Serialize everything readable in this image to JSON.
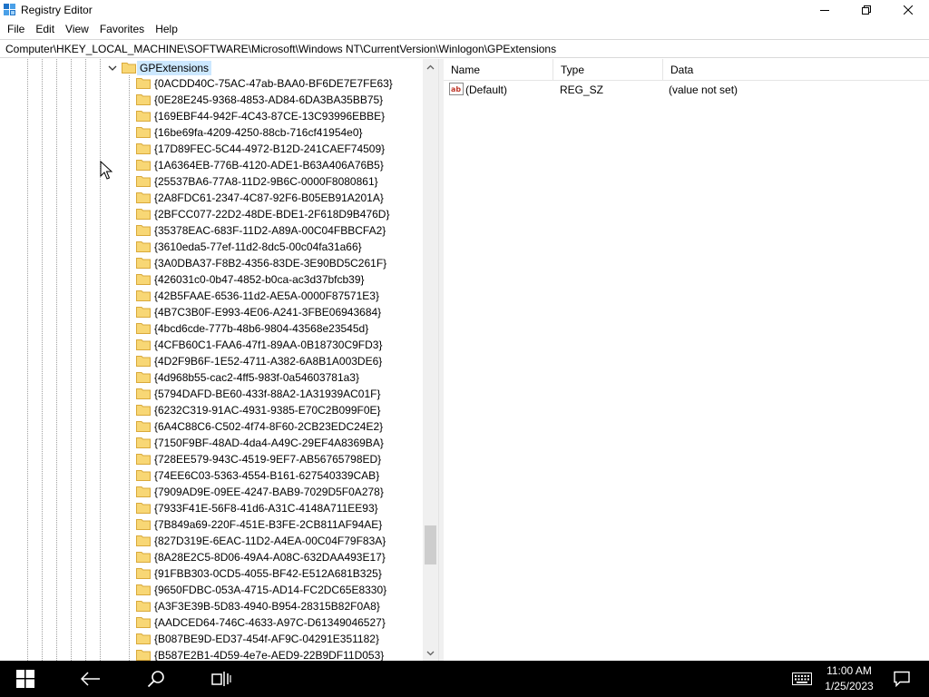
{
  "window": {
    "title": "Registry Editor",
    "minimize_icon": "minimize-icon",
    "maximize_icon": "maximize-icon",
    "close_icon": "close-icon"
  },
  "menu": [
    "File",
    "Edit",
    "View",
    "Favorites",
    "Help"
  ],
  "address": "Computer\\HKEY_LOCAL_MACHINE\\SOFTWARE\\Microsoft\\Windows NT\\CurrentVersion\\Winlogon\\GPExtensions",
  "tree": {
    "selected_key": "GPExtensions",
    "subkeys": [
      "{0ACDD40C-75AC-47ab-BAA0-BF6DE7E7FE63}",
      "{0E28E245-9368-4853-AD84-6DA3BA35BB75}",
      "{169EBF44-942F-4C43-87CE-13C93996EBBE}",
      "{16be69fa-4209-4250-88cb-716cf41954e0}",
      "{17D89FEC-5C44-4972-B12D-241CAEF74509}",
      "{1A6364EB-776B-4120-ADE1-B63A406A76B5}",
      "{25537BA6-77A8-11D2-9B6C-0000F8080861}",
      "{2A8FDC61-2347-4C87-92F6-B05EB91A201A}",
      "{2BFCC077-22D2-48DE-BDE1-2F618D9B476D}",
      "{35378EAC-683F-11D2-A89A-00C04FBBCFA2}",
      "{3610eda5-77ef-11d2-8dc5-00c04fa31a66}",
      "{3A0DBA37-F8B2-4356-83DE-3E90BD5C261F}",
      "{426031c0-0b47-4852-b0ca-ac3d37bfcb39}",
      "{42B5FAAE-6536-11d2-AE5A-0000F87571E3}",
      "{4B7C3B0F-E993-4E06-A241-3FBE06943684}",
      "{4bcd6cde-777b-48b6-9804-43568e23545d}",
      "{4CFB60C1-FAA6-47f1-89AA-0B18730C9FD3}",
      "{4D2F9B6F-1E52-4711-A382-6A8B1A003DE6}",
      "{4d968b55-cac2-4ff5-983f-0a54603781a3}",
      "{5794DAFD-BE60-433f-88A2-1A31939AC01F}",
      "{6232C319-91AC-4931-9385-E70C2B099F0E}",
      "{6A4C88C6-C502-4f74-8F60-2CB23EDC24E2}",
      "{7150F9BF-48AD-4da4-A49C-29EF4A8369BA}",
      "{728EE579-943C-4519-9EF7-AB56765798ED}",
      "{74EE6C03-5363-4554-B161-627540339CAB}",
      "{7909AD9E-09EE-4247-BAB9-7029D5F0A278}",
      "{7933F41E-56F8-41d6-A31C-4148A711EE93}",
      "{7B849a69-220F-451E-B3FE-2CB811AF94AE}",
      "{827D319E-6EAC-11D2-A4EA-00C04F79F83A}",
      "{8A28E2C5-8D06-49A4-A08C-632DAA493E17}",
      "{91FBB303-0CD5-4055-BF42-E512A681B325}",
      "{9650FDBC-053A-4715-AD14-FC2DC65E8330}",
      "{A3F3E39B-5D83-4940-B954-28315B82F0A8}",
      "{AADCED64-746C-4633-A97C-D61349046527}",
      "{B087BE9D-ED37-454f-AF9C-04291E351182}",
      "{B587E2B1-4D59-4e7e-AED9-22B9DF11D053}"
    ]
  },
  "list": {
    "columns": [
      "Name",
      "Type",
      "Data"
    ],
    "rows": [
      {
        "name": "(Default)",
        "type": "REG_SZ",
        "data": "(value not set)",
        "icon": "string-value-icon"
      }
    ]
  },
  "taskbar": {
    "time": "11:00 AM",
    "date": "1/25/2023",
    "icons": [
      "windows-start-icon",
      "back-icon",
      "search-icon",
      "task-view-icon",
      "keyboard-icon",
      "notification-icon"
    ]
  }
}
